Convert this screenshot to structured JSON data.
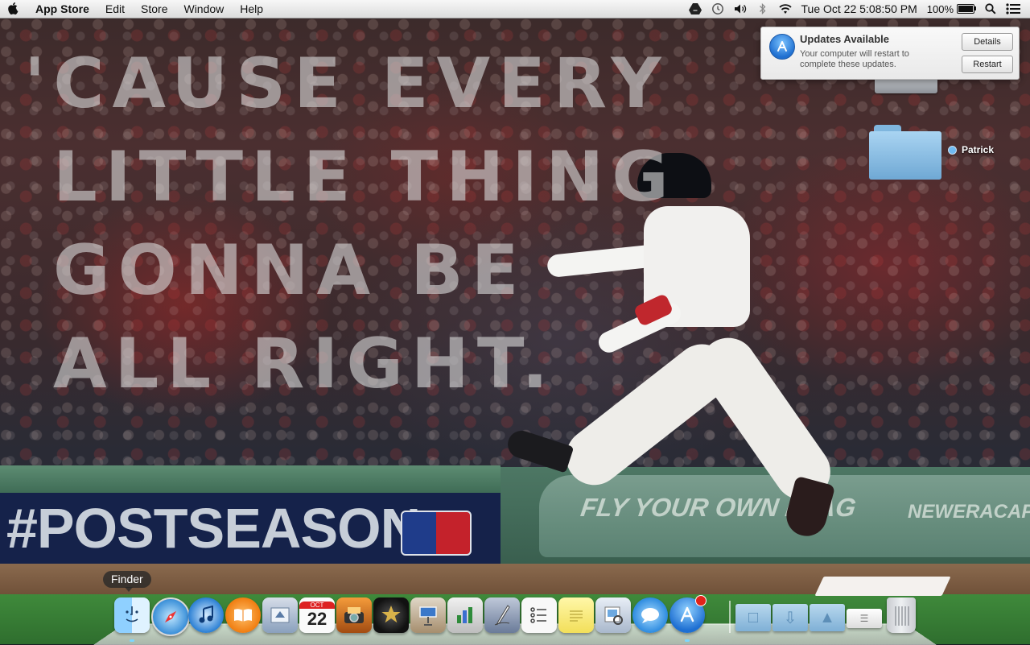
{
  "menubar": {
    "apple_icon": "apple-logo-icon",
    "app_name": "App Store",
    "menus": [
      "Edit",
      "Store",
      "Window",
      "Help"
    ],
    "clock": "Tue Oct 22  5:08:50 PM",
    "battery": "100%",
    "battery_level": 1.0,
    "status_icons": [
      "google-drive-icon",
      "time-machine-icon",
      "volume-icon",
      "bluetooth-icon",
      "wifi-icon",
      "battery-icon",
      "spotlight-icon",
      "notification-center-icon"
    ]
  },
  "notification": {
    "title": "Updates Available",
    "body": "Your computer will restart to complete these updates.",
    "details_button": "Details",
    "restart_button": "Restart",
    "icon": "app-store-icon"
  },
  "wallpaper": {
    "quote_lines": [
      "'CAUSE EVERY",
      "LITTLE THING",
      "GONNA BE",
      "ALL RIGHT."
    ],
    "banner_text": "#POSTSEASON",
    "flag_text": "FLY YOUR OWN FLAG",
    "newera_text": "NEWERACAP"
  },
  "desktop": {
    "folder_label": "Patrick"
  },
  "dock": {
    "tooltip": "Finder",
    "apps": [
      "finder",
      "safari",
      "itunes",
      "ibooks",
      "mail",
      "calendar",
      "iphoto",
      "imovie",
      "keynote",
      "numbers",
      "pages",
      "reminders",
      "stickies",
      "preview",
      "messages",
      "app-store"
    ],
    "calendar_month": "OCT",
    "calendar_day": "22",
    "folders": [
      "documents",
      "downloads",
      "applications",
      "list-view"
    ],
    "trash": "trash-icon"
  }
}
